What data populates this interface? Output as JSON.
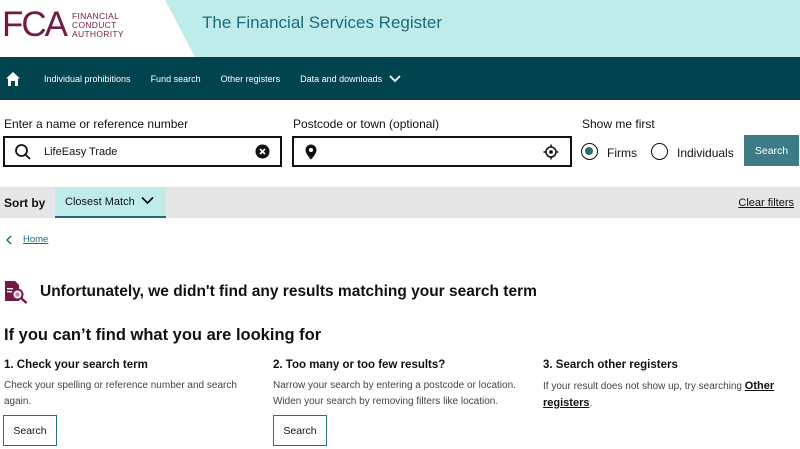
{
  "brand": {
    "logo_mark": "FCA",
    "logo_lines": [
      "FINANCIAL",
      "CONDUCT",
      "AUTHORITY"
    ],
    "title": "The Financial Services Register",
    "primary_color": "#701b45",
    "accent_color": "#014450"
  },
  "nav": {
    "home_icon": "home-icon",
    "items": [
      "Individual prohibitions",
      "Fund search",
      "Other registers",
      "Data and downloads"
    ]
  },
  "search": {
    "name_label": "Enter a name or reference number",
    "name_value": "LifeEasy Trade",
    "postcode_label": "Postcode or town (optional)",
    "postcode_value": "",
    "show_me_first_label": "Show me first",
    "options": [
      {
        "label": "Firms",
        "selected": true
      },
      {
        "label": "Individuals",
        "selected": false
      }
    ],
    "button_label": "Search"
  },
  "sort": {
    "label": "Sort by",
    "selected": "Closest Match",
    "clear_label": "Clear filters"
  },
  "breadcrumb": {
    "home_label": "Home"
  },
  "results": {
    "no_results_message": "Unfortunately, we didn't find any results matching your search term",
    "help_heading": "If you can’t find what you are looking for",
    "tips": [
      {
        "title": "1. Check your search term",
        "text": "Check your spelling or reference number and search again.",
        "button": "Search"
      },
      {
        "title": "2. Too many or too few results?",
        "text": "Narrow your search by entering a postcode or location. Widen your search by removing filters like location.",
        "button": "Search"
      },
      {
        "title": "3. Search other registers",
        "text_before": "If your result does not show up, try searching ",
        "link": "Other registers",
        "text_after": "."
      }
    ]
  }
}
